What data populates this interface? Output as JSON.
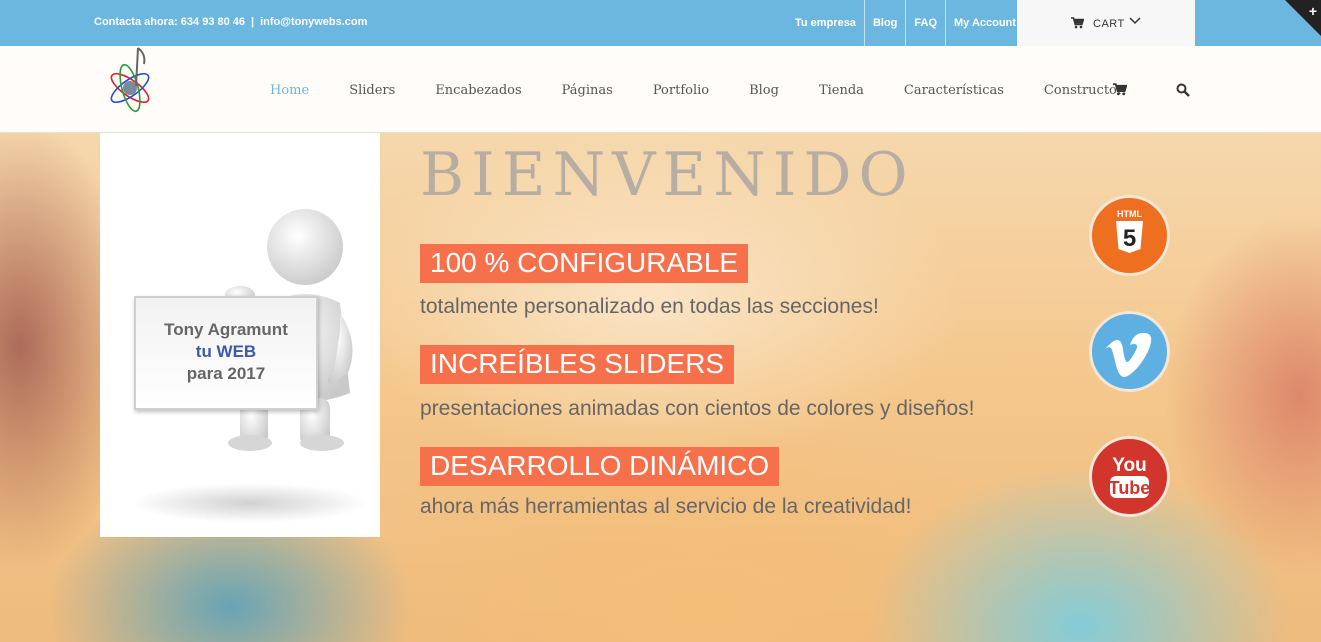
{
  "topbar": {
    "contact": "Contacta ahora: 634 93 80 46",
    "separator": "|",
    "email": "info@tonywebs.com",
    "links": [
      "Tu empresa",
      "Blog",
      "FAQ",
      "My Account"
    ],
    "cart_label": "CART",
    "corner_symbol": "+"
  },
  "nav": {
    "items": [
      "Home",
      "Sliders",
      "Encabezados",
      "Páginas",
      "Portfolio",
      "Blog",
      "Tienda",
      "Características",
      "Constructor"
    ],
    "active": "Home",
    "active_color": "#6cb7e0"
  },
  "panel": {
    "sign_line1": "Tony Agramunt",
    "sign_line2": "tu WEB",
    "sign_line3": "para 2017"
  },
  "hero": {
    "title": "BIENVENIDO",
    "features": [
      {
        "badge": "100 % CONFIGURABLE",
        "text": "totalmente personalizado en todas las secciones!"
      },
      {
        "badge": "INCREÍBLES SLIDERS",
        "text": "presentaciones animadas con cientos de colores y diseños!"
      },
      {
        "badge": "DESARROLLO DINÁMICO",
        "text": "ahora más herramientas al servicio de la creatividad!"
      }
    ],
    "badge_color": "#f6704c"
  },
  "social": {
    "html5": {
      "label": "HTML",
      "number": "5",
      "color": "#ee6f1f"
    },
    "vimeo": {
      "color": "#5fb0e2"
    },
    "youtube": {
      "line1": "You",
      "line2": "Tube",
      "color": "#d1352b"
    }
  }
}
